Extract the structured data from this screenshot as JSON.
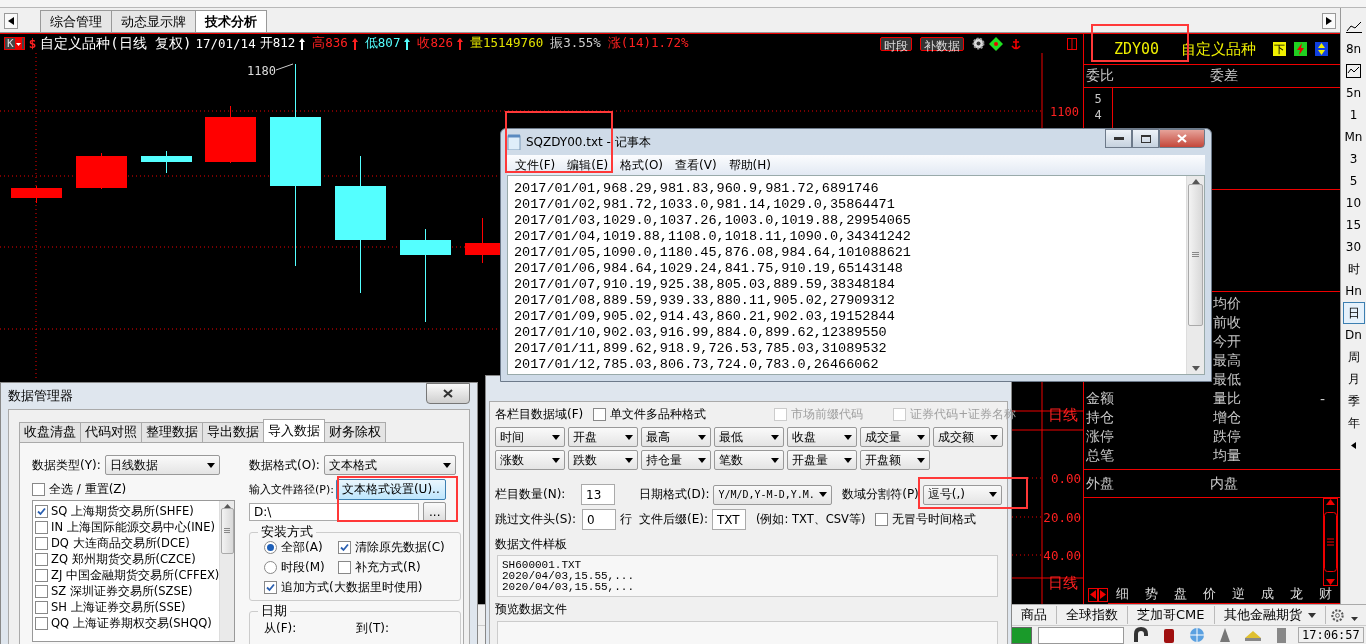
{
  "tabs": [
    {
      "label": "综合管理",
      "selected": false
    },
    {
      "label": "动态显示牌",
      "selected": false
    },
    {
      "label": "技术分析",
      "selected": true
    }
  ],
  "chart": {
    "period_button": "K",
    "symbol": "$",
    "title": "自定义品种(日线 复权)",
    "date": "17/01/14",
    "fields": [
      {
        "text": "开812",
        "color": "#ffffff",
        "arrow": true
      },
      {
        "text": "高836",
        "color": "#ff2020",
        "arrow": true
      },
      {
        "text": "低807",
        "color": "#54ffff",
        "arrow": true
      },
      {
        "text": "收826",
        "color": "#ff2020",
        "arrow": true
      },
      {
        "text": "量15149760",
        "color": "#e0e000",
        "arrow": false
      },
      {
        "text": "振3.55%",
        "color": "#d0d0d0",
        "arrow": false
      },
      {
        "text": "涨(14)1.72%",
        "color": "#ff2020",
        "arrow": false
      }
    ],
    "buttons": [
      "时段",
      "补数据"
    ],
    "peak_label": "1180",
    "price_label": "1100",
    "lower_labels": [
      {
        "text": "日线",
        "kind": "name"
      },
      {
        "text": "0.00",
        "kind": "tick"
      },
      {
        "text": "20.00",
        "kind": "tick"
      },
      {
        "text": "40.00",
        "kind": "tick"
      },
      {
        "text": "日线",
        "kind": "name"
      }
    ]
  },
  "quote": {
    "code": "ZDY00",
    "name": "自定义品种",
    "sell_button": "下",
    "header": [
      "委比",
      "委差"
    ],
    "levels": [
      "5",
      "4"
    ],
    "rows": [
      {
        "right": "均价"
      },
      {
        "right": "前收"
      },
      {
        "right": "今开"
      },
      {
        "right": "最高"
      },
      {
        "right": "最低"
      },
      {
        "left": "金额",
        "right": "量比",
        "value": "-"
      },
      {
        "left": "持仓",
        "right": "增仓"
      },
      {
        "left": "涨停",
        "right": "跌停"
      },
      {
        "left": "总笔",
        "right": "均量"
      }
    ],
    "outer": [
      "外盘",
      "内盘"
    ],
    "tabs": [
      "细",
      "势",
      "盘",
      "价",
      "逆",
      "成",
      "龙",
      "财"
    ]
  },
  "sidebar": [
    {
      "kind": "line-chart",
      "selected": false
    },
    {
      "kind": "text",
      "label": "8n",
      "selected": false
    },
    {
      "kind": "box-chart",
      "selected": false
    },
    {
      "kind": "text",
      "label": "5n",
      "selected": false
    },
    {
      "kind": "text",
      "label": "1",
      "selected": false
    },
    {
      "kind": "text",
      "label": "Mn",
      "selected": false
    },
    {
      "kind": "text",
      "label": "3",
      "selected": false
    },
    {
      "kind": "text",
      "label": "5",
      "selected": false
    },
    {
      "kind": "text",
      "label": "10",
      "selected": false
    },
    {
      "kind": "text",
      "label": "15",
      "selected": false
    },
    {
      "kind": "text",
      "label": "30",
      "selected": false
    },
    {
      "kind": "text",
      "label": "时",
      "selected": false
    },
    {
      "kind": "text",
      "label": "Hn",
      "selected": false
    },
    {
      "kind": "text",
      "label": "日",
      "selected": true
    },
    {
      "kind": "text",
      "label": "Dn",
      "selected": false
    },
    {
      "kind": "text",
      "label": "周",
      "selected": false
    },
    {
      "kind": "text",
      "label": "月",
      "selected": false
    },
    {
      "kind": "text",
      "label": "季",
      "selected": false
    },
    {
      "kind": "text",
      "label": "年",
      "selected": false
    },
    {
      "kind": "arrow",
      "selected": false
    }
  ],
  "bottom_tabs": [
    {
      "label": "商品",
      "dropdown": false
    },
    {
      "label": "全球指数",
      "dropdown": false
    },
    {
      "label": "芝加哥CME",
      "dropdown": false
    },
    {
      "label": "其他金融期货",
      "dropdown": true
    }
  ],
  "status": {
    "time": "17:06:57"
  },
  "notepad": {
    "title": "SQZDY00.txt - 记事本",
    "menu": [
      "文件(F)",
      "编辑(E)",
      "格式(O)",
      "查看(V)",
      "帮助(H)"
    ],
    "lines": [
      "2017/01/01,968.29,981.83,960.9,981.72,6891746",
      "2017/01/02,981.72,1033.0,981.14,1029.0,35864471",
      "2017/01/03,1029.0,1037.26,1003.0,1019.88,29954065",
      "2017/01/04,1019.88,1108.0,1018.11,1090.0,34341242",
      "2017/01/05,1090.0,1180.45,876.08,984.64,101088621",
      "2017/01/06,984.64,1029.24,841.75,910.19,65143148",
      "2017/01/07,910.19,925.38,805.03,889.59,38348184",
      "2017/01/08,889.59,939.33,880.11,905.02,27909312",
      "2017/01/09,905.02,914.43,860.21,902.03,19152844",
      "2017/01/10,902.03,916.99,884.0,899.62,12389550",
      "2017/01/11,899.62,918.9,726.53,785.03,31089532",
      "2017/01/12,785.03,806.73,724.0,783.0,26466062"
    ]
  },
  "data_manager": {
    "title": "数据管理器",
    "tabs": [
      {
        "label": "收盘清盘",
        "selected": false
      },
      {
        "label": "代码对照",
        "selected": false
      },
      {
        "label": "整理数据",
        "selected": false
      },
      {
        "label": "导出数据",
        "selected": false
      },
      {
        "label": "导入数据",
        "selected": true
      },
      {
        "label": "财务除权",
        "selected": false
      }
    ],
    "data_type_label": "数据类型(Y):",
    "data_type": "日线数据",
    "select_all": {
      "label": "全选 / 重置(Z)",
      "checked": false
    },
    "exchanges": [
      {
        "label": "SQ 上海期货交易所(SHFE)",
        "checked": true
      },
      {
        "label": "IN 上海国际能源交易中心(INE)",
        "checked": false
      },
      {
        "label": "DQ 大连商品交易所(DCE)",
        "checked": false
      },
      {
        "label": "ZQ 郑州期货交易所(CZCE)",
        "checked": false
      },
      {
        "label": "ZJ 中国金融期货交易所(CFFEX)",
        "checked": false
      },
      {
        "label": "SZ 深圳证券交易所(SZSE)",
        "checked": false
      },
      {
        "label": "SH 上海证券交易所(SSE)",
        "checked": false
      },
      {
        "label": "QQ 上海证券期权交易(SHQQ)",
        "checked": false
      }
    ],
    "format_label": "数据格式(O):",
    "format": "文本格式",
    "path_label": "输入文件路径(P):",
    "settings_button": "文本格式设置(U)..",
    "path": "D:\\",
    "browse_button": "...",
    "install": {
      "title": "安装方式",
      "options": [
        {
          "kind": "radio",
          "label": "全部(A)",
          "checked": true
        },
        {
          "kind": "checkbox",
          "label": "清除原先数据(C)",
          "checked": true
        },
        {
          "kind": "radio",
          "label": "时段(M)",
          "checked": false
        },
        {
          "kind": "checkbox",
          "label": "补充方式(R)",
          "checked": false
        },
        {
          "kind": "checkbox",
          "label": "追加方式(大数据里时使用)",
          "checked": true
        }
      ]
    },
    "date_group": {
      "title": "日期",
      "from": "从(F):",
      "to": "到(T):"
    }
  },
  "format_dialog": {
    "fields_label": "各栏目数据域(F)",
    "options": [
      {
        "label": "单文件多品种格式",
        "checked": false,
        "disabled": false
      },
      {
        "label": "市场前缀代码",
        "checked": false,
        "disabled": true
      },
      {
        "label": "证券代码+证券名称",
        "checked": false,
        "disabled": true
      }
    ],
    "columns": [
      "时间",
      "开盘",
      "最高",
      "最低",
      "收盘",
      "成交量",
      "成交额",
      "涨数",
      "跌数",
      "持仓量",
      "笔数",
      "开盘量",
      "开盘额"
    ],
    "count_label": "栏目数量(N):",
    "count": "13",
    "date_format_label": "日期格式(D):",
    "date_format": "Y/M/D,Y-M-D,Y.M.",
    "separator_label": "数域分割符(P)",
    "separator": "逗号(,)",
    "skip_label": "跳过文件头(S):",
    "skip": "0",
    "skip_unit": "行",
    "ext_label": "文件后缀(E):",
    "ext": "TXT",
    "ext_hint": "(例如: TXT、CSV等)",
    "colon_option": {
      "label": "无冒号时间格式",
      "checked": false
    },
    "template_label": "数据文件样板",
    "template_lines": [
      "SH600001.TXT",
      "2020/04/03,15.55,...",
      "2020/04/03,15.55,..."
    ],
    "preview_label": "预览数据文件"
  }
}
